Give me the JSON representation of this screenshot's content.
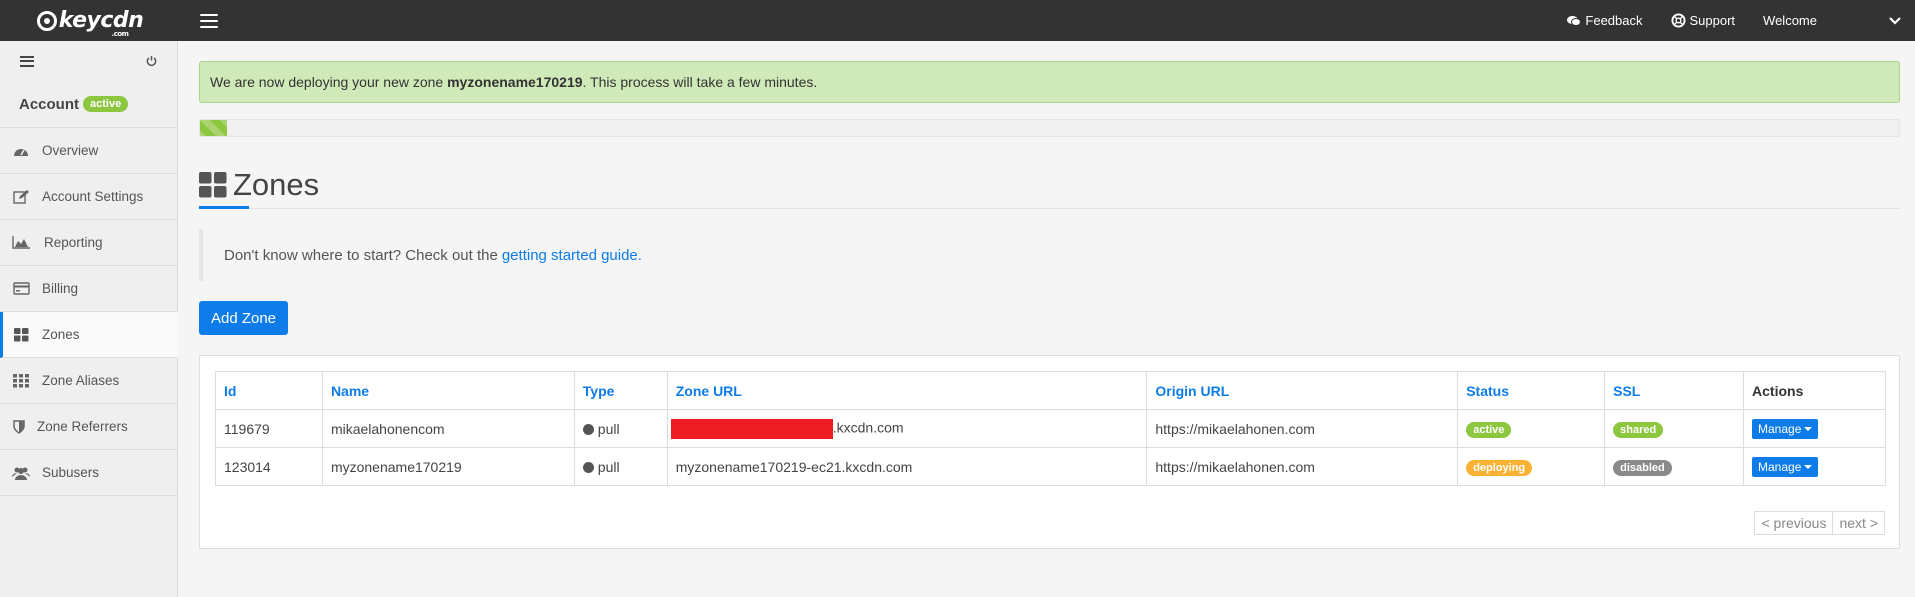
{
  "topbar": {
    "logo_text": "keycdn",
    "logo_sub": ".com",
    "feedback": "Feedback",
    "support": "Support",
    "welcome": "Welcome"
  },
  "sidebar": {
    "account_label": "Account",
    "account_badge": "active",
    "items": [
      {
        "label": "Overview",
        "icon": "dashboard-icon"
      },
      {
        "label": "Account Settings",
        "icon": "edit-icon"
      },
      {
        "label": "Reporting",
        "icon": "area-chart-icon"
      },
      {
        "label": "Billing",
        "icon": "credit-card-icon"
      },
      {
        "label": "Zones",
        "icon": "grid-icon",
        "active": true
      },
      {
        "label": "Zone Aliases",
        "icon": "th-icon"
      },
      {
        "label": "Zone Referrers",
        "icon": "shield-icon"
      },
      {
        "label": "Subusers",
        "icon": "users-icon"
      }
    ]
  },
  "alert": {
    "prefix": "We are now deploying your new zone ",
    "zone": "myzonename170219",
    "suffix": ". This process will take a few minutes."
  },
  "deploy_progress": 0.016,
  "page_title": "Zones",
  "hint": {
    "text": "Don't know where to start? Check out the",
    "link": "getting started guide."
  },
  "add_zone_label": "Add Zone",
  "table": {
    "headers": [
      "Id",
      "Name",
      "Type",
      "Zone URL",
      "Origin URL",
      "Status",
      "SSL",
      "Actions"
    ],
    "rows": [
      {
        "id": "119679",
        "name": "mikaelahonencom",
        "type": "pull",
        "zone_url_suffix": ".kxcdn.com",
        "origin": "https://mikaelahonen.com",
        "status": "active",
        "ssl": "shared",
        "action": "Manage"
      },
      {
        "id": "123014",
        "name": "myzonename170219",
        "type": "pull",
        "zone_url": "myzonename170219-ec21.kxcdn.com",
        "origin": "https://mikaelahonen.com",
        "status": "deploying",
        "ssl": "disabled",
        "action": "Manage"
      }
    ]
  },
  "pager": {
    "previous": "< previous",
    "next": "next >"
  },
  "colors": {
    "accent": "#0d7ce8",
    "success": "#8dc63f",
    "warning": "#f9b233",
    "muted": "#8a8a8a",
    "topbar": "#333333"
  }
}
